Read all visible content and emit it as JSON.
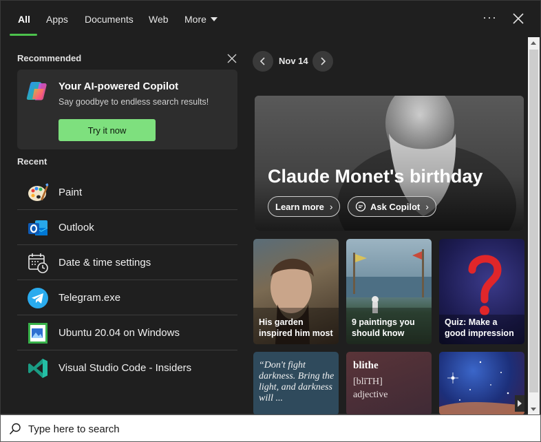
{
  "tabs": {
    "all": "All",
    "apps": "Apps",
    "documents": "Documents",
    "web": "Web",
    "more": "More",
    "options": "···"
  },
  "recommended": {
    "heading": "Recommended",
    "card": {
      "title": "Your AI-powered Copilot",
      "subtitle": "Say goodbye to endless search results!",
      "button": "Try it now"
    }
  },
  "recent": {
    "heading": "Recent",
    "items": [
      {
        "label": "Paint",
        "icon": "paint-icon"
      },
      {
        "label": "Outlook",
        "icon": "outlook-icon"
      },
      {
        "label": "Date & time settings",
        "icon": "calendar-clock-icon"
      },
      {
        "label": "Telegram.exe",
        "icon": "telegram-icon"
      },
      {
        "label": "Ubuntu 20.04 on Windows",
        "icon": "ubuntu-icon"
      },
      {
        "label": "Visual Studio Code - Insiders",
        "icon": "vscode-icon"
      }
    ]
  },
  "highlights": {
    "date": "Nov 14",
    "hero": {
      "title": "Claude Monet's birthday",
      "learn_more": "Learn more",
      "ask_copilot": "Ask Copilot"
    },
    "tiles": [
      {
        "caption_line1": "His garden",
        "caption_line2": "inspired him most"
      },
      {
        "caption_line1": "9 paintings you",
        "caption_line2": "should know"
      },
      {
        "caption_line1": "Quiz: Make a",
        "caption_line2": "good impression"
      }
    ],
    "quote": "“Don't fight darkness. Bring the light, and darkness will ...",
    "word": {
      "term": "blithe",
      "phonetic": "[blīTH]",
      "part_of_speech": "adjective"
    }
  },
  "search": {
    "placeholder": "Type here to search"
  },
  "colors": {
    "accent": "#4cc24c",
    "try_button": "#7ee07e",
    "panel": "#1f1f1f",
    "card": "#2d2d2d"
  }
}
